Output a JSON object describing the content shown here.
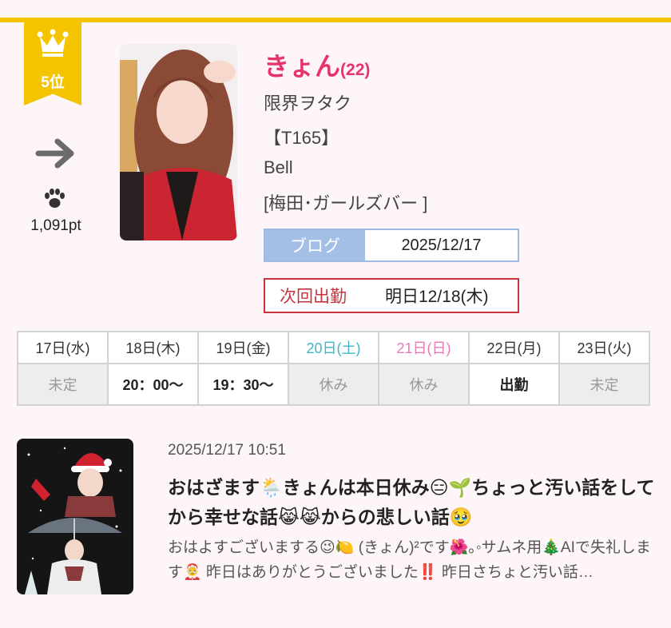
{
  "rank": {
    "label": "5位",
    "trend": "right-arrow-icon"
  },
  "points": "1,091pt",
  "cast": {
    "name": "きょん",
    "age": "(22)",
    "catchphrase": "限界ヲタク",
    "height": "【T165】",
    "shop": "Bell",
    "area": "[梅田･ガールズバー ]"
  },
  "blog": {
    "label": "ブログ",
    "date": "2025/12/17"
  },
  "next_shift": {
    "label": "次回出勤",
    "value": "明日12/18(木)"
  },
  "schedule": {
    "days": [
      {
        "day": "17日(水)",
        "status": "未定",
        "working": false,
        "color": "normal"
      },
      {
        "day": "18日(木)",
        "status": "20：00〜",
        "working": true,
        "color": "normal"
      },
      {
        "day": "19日(金)",
        "status": "19：30〜",
        "working": true,
        "color": "normal"
      },
      {
        "day": "20日(土)",
        "status": "休み",
        "working": false,
        "color": "saturday"
      },
      {
        "day": "21日(日)",
        "status": "休み",
        "working": false,
        "color": "sunday"
      },
      {
        "day": "22日(月)",
        "status": "出勤",
        "working": true,
        "color": "normal"
      },
      {
        "day": "23日(火)",
        "status": "未定",
        "working": false,
        "color": "normal"
      }
    ]
  },
  "post": {
    "datetime": "2025/12/17 10:51",
    "title": "おはざます🌦️きょんは本日休み😑🌱ちょっと汚い話をしてから幸せな話😹😹からの悲しい話🥹",
    "excerpt": "おはよすございまする😉🍋 (きょん)²です🌺｡◦サムネ用🎄AIで失礼します🤶 昨日はありがとうございました‼️ 昨日さちょと汚い話…"
  },
  "colors": {
    "accent_yellow": "#f5c400",
    "name_pink": "#e6336b",
    "blog_blue": "#a4bfe6",
    "next_red": "#c8343e"
  }
}
